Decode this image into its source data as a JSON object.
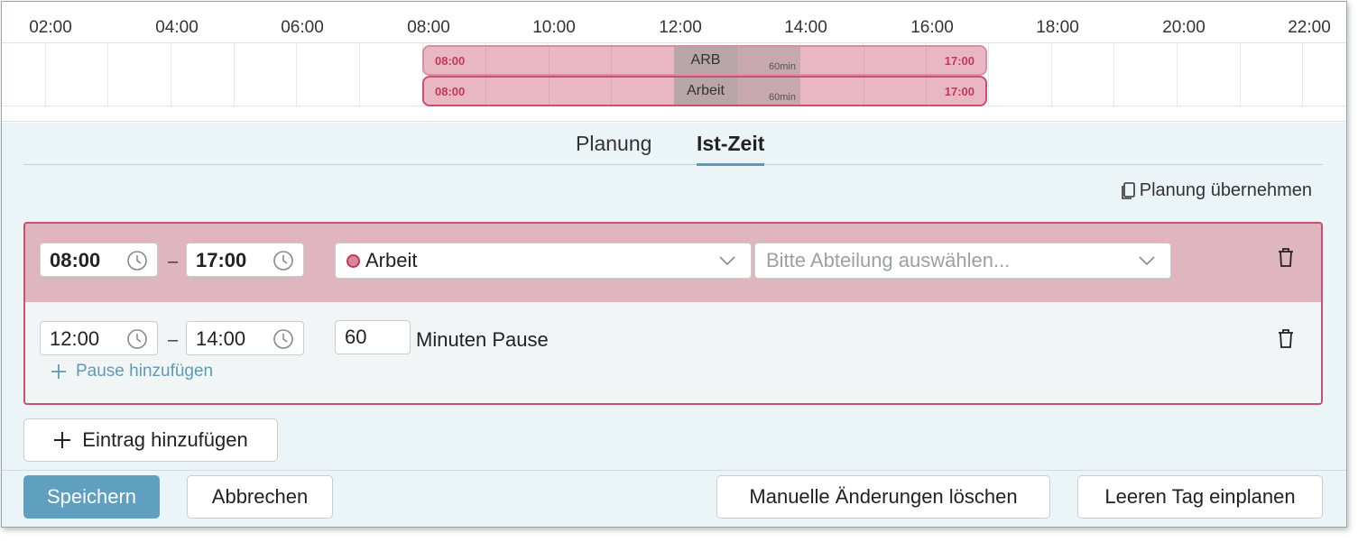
{
  "timeline": {
    "hours": [
      "02:00",
      "04:00",
      "06:00",
      "08:00",
      "10:00",
      "12:00",
      "14:00",
      "16:00",
      "18:00",
      "20:00",
      "22:00"
    ],
    "bars": [
      {
        "start": "08:00",
        "end": "17:00",
        "name": "ARB",
        "pause": "60min"
      },
      {
        "start": "08:00",
        "end": "17:00",
        "name": "Arbeit",
        "pause": "60min"
      }
    ]
  },
  "tabs": {
    "planung": "Planung",
    "ist_zeit": "Ist-Zeit"
  },
  "copy_link": "Planung übernehmen",
  "entry": {
    "start": "08:00",
    "end": "17:00",
    "dash": "–",
    "type": "Arbeit",
    "department_placeholder": "Bitte Abteilung auswählen...",
    "pause": {
      "start": "12:00",
      "end": "14:00",
      "minutes": "60",
      "minutes_label": "Minuten Pause",
      "add_label": "Pause hinzufügen"
    }
  },
  "buttons": {
    "add_entry": "Eintrag hinzufügen",
    "save": "Speichern",
    "cancel": "Abbrechen",
    "clear_manual": "Manuelle Änderungen löschen",
    "plan_empty": "Leeren Tag einplanen"
  },
  "colors": {
    "accent": "#5f9fbf",
    "entry_border": "#c9506e",
    "entry_bg": "#dfb5c0",
    "bar_fill": "#e9b7c3",
    "time_text": "#c0395b"
  }
}
